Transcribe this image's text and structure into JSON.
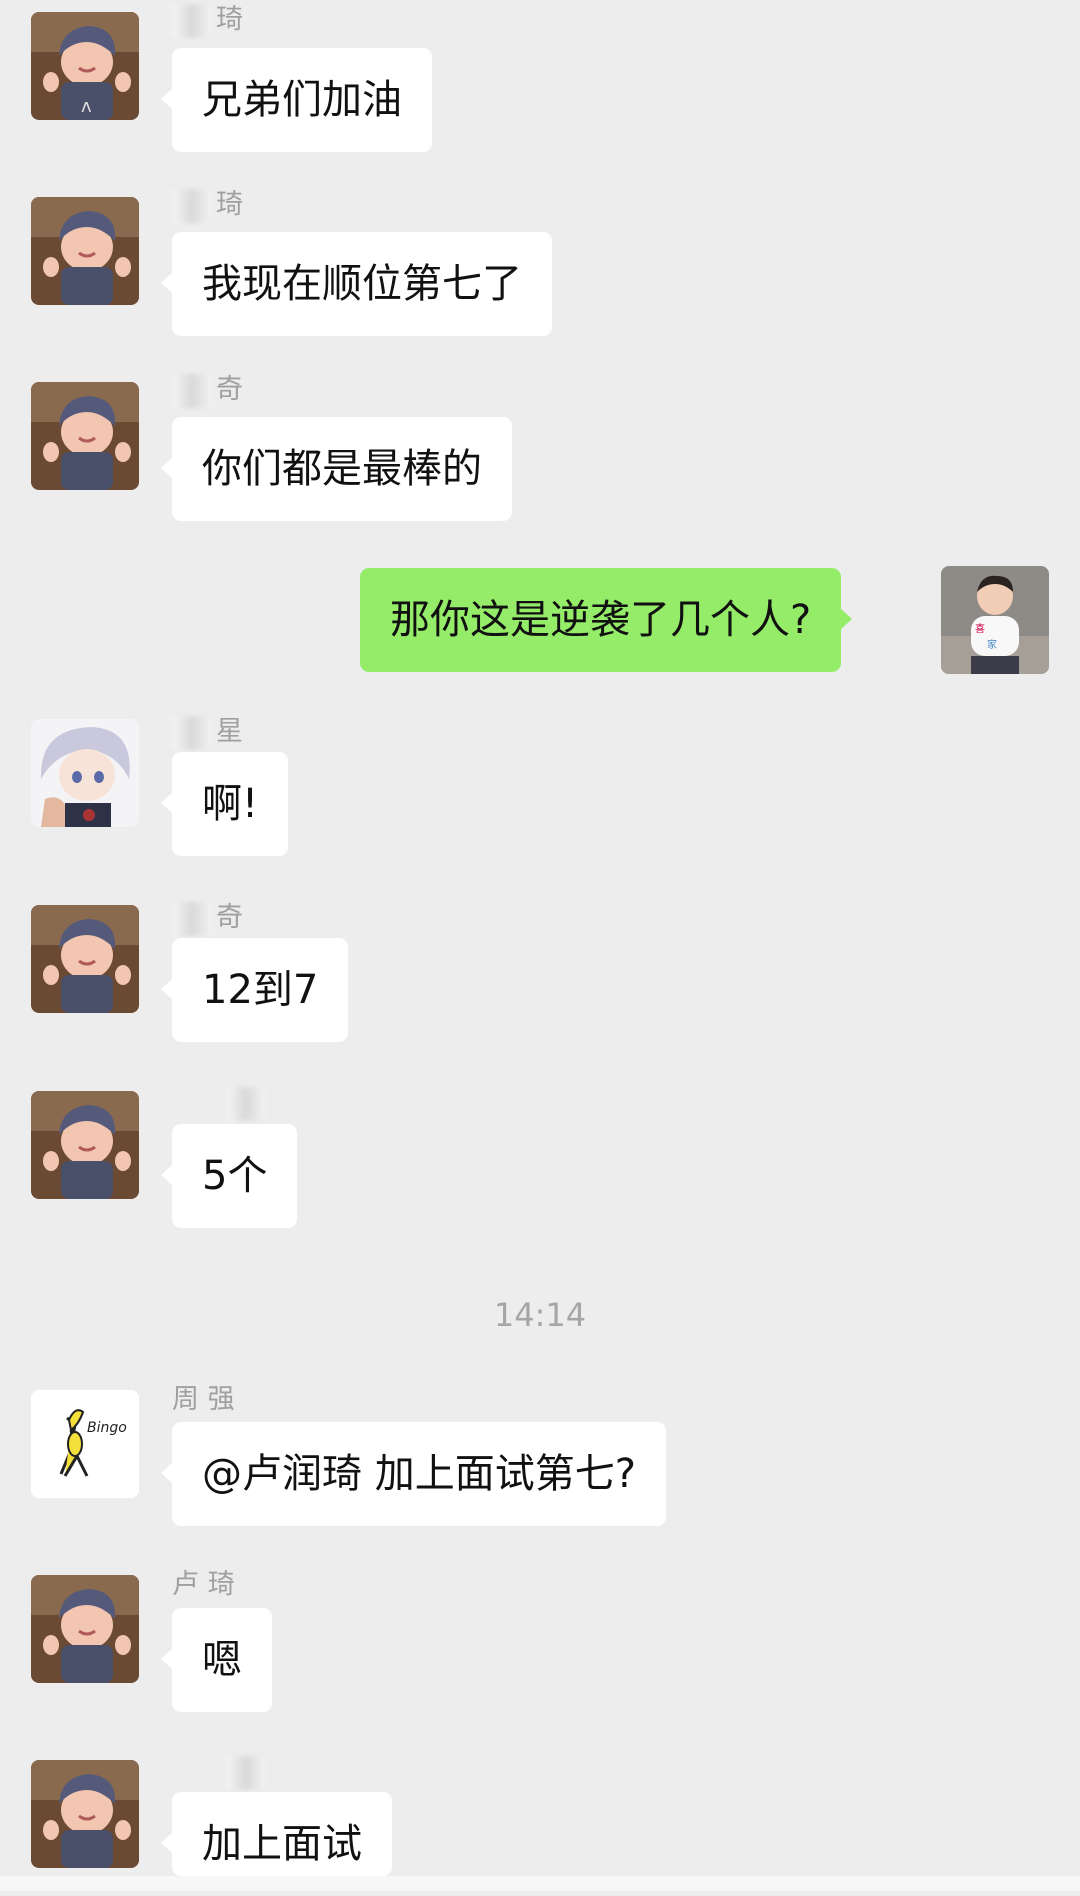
{
  "messages": [
    {
      "side": "left",
      "avatar": "baby-hat-avatar-icon",
      "name": "琦",
      "text": "兄弟们加油"
    },
    {
      "side": "left",
      "avatar": "baby-hat-avatar-icon",
      "name": "琦",
      "text": "我现在顺位第七了"
    },
    {
      "side": "left",
      "avatar": "baby-hat-avatar-icon",
      "name": "奇",
      "text": "你们都是最棒的"
    },
    {
      "side": "right",
      "avatar": "child-photo-avatar-icon",
      "text": "那你这是逆袭了几个人?"
    },
    {
      "side": "left",
      "avatar": "anime-white-hair-avatar-icon",
      "name": "星",
      "text": "啊!"
    },
    {
      "side": "left",
      "avatar": "baby-hat-avatar-icon",
      "name": "奇",
      "text": "12到7"
    },
    {
      "side": "left",
      "avatar": "baby-hat-avatar-icon",
      "name": "",
      "text": "5个"
    },
    {
      "side": "left",
      "avatar": "bingo-sticker-avatar-icon",
      "name": "周 强",
      "text": "@卢润琦 加上面试第七?"
    },
    {
      "side": "left",
      "avatar": "baby-hat-avatar-icon",
      "name": "卢 琦",
      "text": "嗯"
    },
    {
      "side": "left",
      "avatar": "baby-hat-avatar-icon",
      "name": "",
      "text": "加上面试"
    }
  ],
  "timestamp": "14:14",
  "colors": {
    "background": "#ededed",
    "bubble_left": "#ffffff",
    "bubble_right": "#95ec69"
  },
  "bingo_text": "Bingo"
}
